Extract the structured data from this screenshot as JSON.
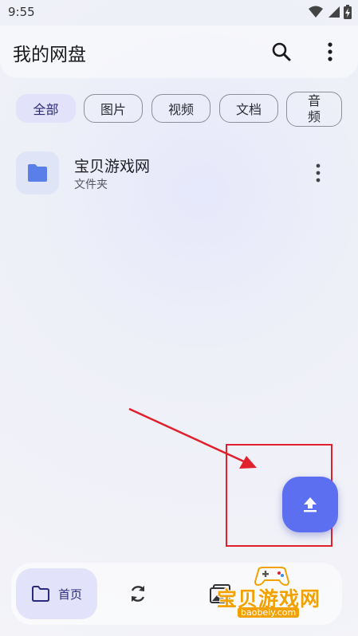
{
  "status": {
    "time": "9:55"
  },
  "appbar": {
    "title": "我的网盘"
  },
  "chips": [
    {
      "label": "全部",
      "active": true
    },
    {
      "label": "图片"
    },
    {
      "label": "视频"
    },
    {
      "label": "文档"
    },
    {
      "label_line1": "音",
      "label_line2": "频"
    }
  ],
  "files": [
    {
      "name": "宝贝游戏网",
      "type": "文件夹"
    }
  ],
  "bottomnav": {
    "home_label": "首页"
  },
  "watermark": {
    "text": "宝贝游戏网",
    "url": "baobeiy.com"
  },
  "colors": {
    "accent": "#5b6ff0",
    "folder": "#5b7fe8",
    "annotation": "#e0202c",
    "watermark": "#f2a100"
  },
  "icons": [
    "wifi-icon",
    "signal-icon",
    "battery-icon",
    "search-icon",
    "more-vert-icon",
    "folder-icon",
    "upload-icon",
    "sync-icon",
    "gallery-icon"
  ]
}
